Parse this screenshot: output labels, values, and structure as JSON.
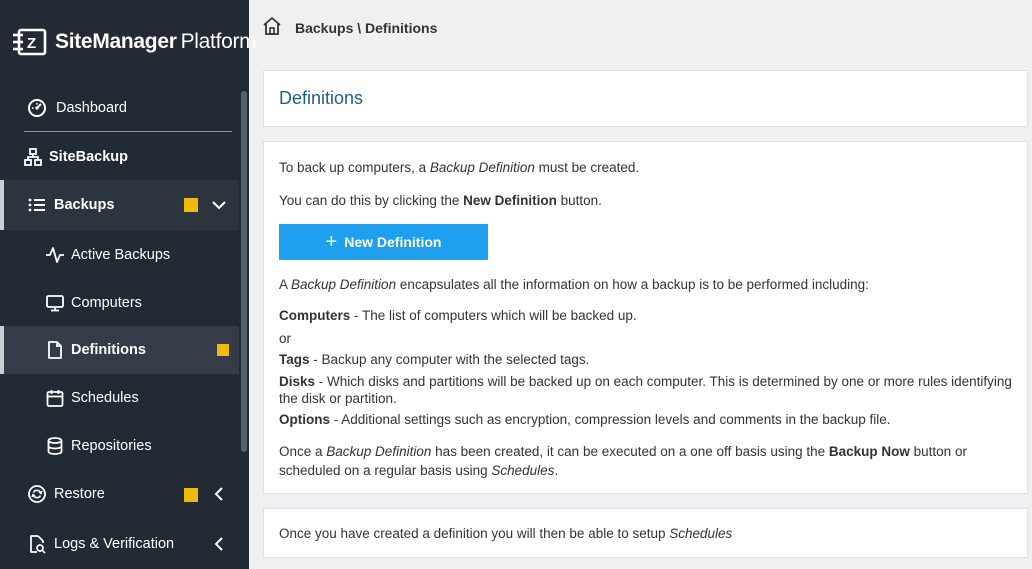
{
  "app": {
    "brand_bold": "SiteManager",
    "brand_light": "Platform"
  },
  "sidebar": {
    "items": [
      {
        "label": "Dashboard",
        "icon": "dashboard-icon"
      },
      {
        "label": "SiteBackup",
        "icon": "sitemap-icon"
      },
      {
        "label": "Backups",
        "icon": "list-icon",
        "badge": true,
        "expanded": true
      },
      {
        "label": "Active Backups",
        "icon": "activity-icon"
      },
      {
        "label": "Computers",
        "icon": "monitor-icon"
      },
      {
        "label": "Definitions",
        "icon": "file-icon",
        "badge": true,
        "selected": true
      },
      {
        "label": "Schedules",
        "icon": "calendar-icon"
      },
      {
        "label": "Repositories",
        "icon": "database-icon"
      },
      {
        "label": "Restore",
        "icon": "restore-icon",
        "badge": true
      },
      {
        "label": "Logs & Verification",
        "icon": "file-search-icon"
      }
    ],
    "badge_color": "#f0b90b"
  },
  "breadcrumb": {
    "text": "Backups \\ Definitions"
  },
  "main": {
    "title": "Definitions",
    "intro": {
      "line1_a": "To back up computers, a ",
      "line1_b": "Backup Definition",
      "line1_c": " must be created.",
      "line2_a": "You can do this by clicking the ",
      "line2_b": "New Definition",
      "line2_c": " button."
    },
    "new_button": "New Definition",
    "description": {
      "a": "A ",
      "b": "Backup Definition",
      "c": " encapsulates all the information on how a backup is to be performed including:"
    },
    "computers": {
      "term": "Computers",
      "text": " - The list of computers which will be backed up."
    },
    "or": "or",
    "tags": {
      "term": "Tags",
      "text": " - Backup any computer with the selected tags."
    },
    "disks": {
      "term": "Disks",
      "text": " - Which disks and partitions will be backed up on each computer. This is determined by one or more rules identifying the disk or partition."
    },
    "options": {
      "term": "Options",
      "text": " - Additional settings such as encryption, compression levels and comments in the backup file."
    },
    "once": {
      "a": "Once a ",
      "b": "Backup Definition",
      "c": " has been created, it can be executed on a one off basis using the ",
      "d": "Backup Now",
      "e": " button or",
      "f": "scheduled on a regular basis using ",
      "g": "Schedules",
      "h": "."
    },
    "footer": {
      "a": "Once you have created a definition you will then be able to setup ",
      "b": "Schedules"
    }
  }
}
